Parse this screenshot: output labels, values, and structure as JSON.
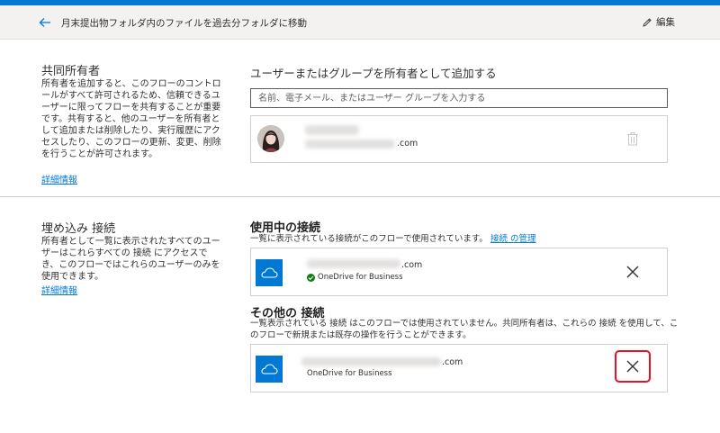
{
  "header": {
    "title": "月末提出物フォルダ内のファイルを過去分フォルダに移動",
    "edit_label": "編集"
  },
  "owners": {
    "title": "共同所有者",
    "description": "所有者を追加すると、このフローのコントロールがすべて許可されるため、信頼できるユーザーに限ってフローを共有することが重要です。共有すると、他のユーザーを所有者として追加または削除したり、実行履歴にアクセスしたり、このフローの更新、変更、削除を行うことが許可されます。",
    "link": "詳細情報",
    "add_title": "ユーザーまたはグループを所有者として追加する",
    "input_placeholder": "名前、電子メール、またはユーザー グループを入力する",
    "owner_email_suffix": ".com"
  },
  "connections": {
    "title": "埋め込み 接続",
    "description": "所有者として一覧に表示されたすべてのユーザーはこれらすべての 接続 にアクセスでき、このフローではこれらのユーザーのみを使用できます。",
    "link": "詳細情報",
    "in_use_title": "使用中の接続",
    "in_use_desc": "一覧に表示されている接続がこのフローで使用されています。",
    "manage_link": "接続 の管理",
    "other_title": "その他の 接続",
    "other_desc": "一覧表示されている 接続 はこのフローでは使用されていません。共同所有者は、これらの 接続 を使用して、このフローで新規または既存の操作を行うことができます。",
    "in_use_items": [
      {
        "email_suffix": ".com",
        "service": "OneDrive for Business",
        "status": "connected"
      }
    ],
    "other_items": [
      {
        "email_suffix": ".com",
        "service": "OneDrive for Business"
      }
    ]
  },
  "colors": {
    "accent": "#0078d4",
    "highlight": "#e81123",
    "status_ok": "#107c10"
  },
  "icons": [
    "back-arrow-icon",
    "pencil-icon",
    "trash-icon",
    "onedrive-icon",
    "check-icon",
    "close-icon"
  ]
}
